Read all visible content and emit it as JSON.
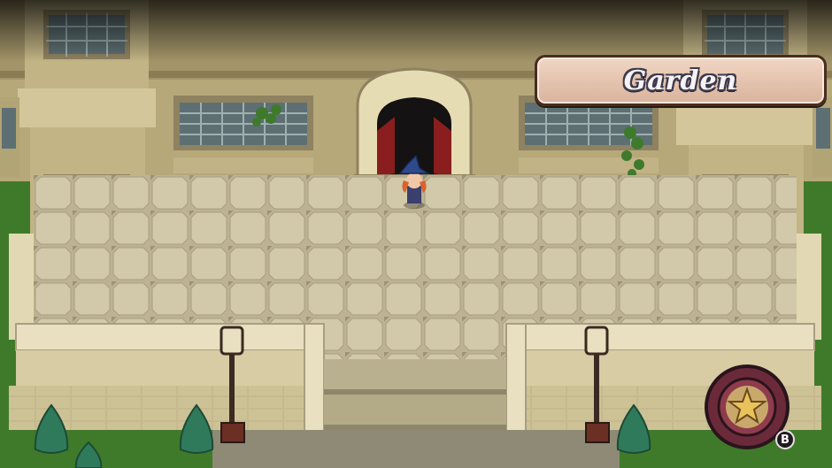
{
  "location": {
    "name": "Garden"
  },
  "hud": {
    "action_button_key": "B",
    "action_icon": "star-icon"
  },
  "palette": {
    "grass": "#3f7a2a",
    "stone": "#cfc39a",
    "tile": "#c9bfa0",
    "shadow": "#1d1a14",
    "banner": "#e3c3af",
    "door": "#8a1d1d",
    "star": "#e8c25a"
  },
  "characters": [
    {
      "name": "witch-player",
      "hat_color": "#2f4a8c",
      "hair_color": "#d9642c"
    }
  ]
}
